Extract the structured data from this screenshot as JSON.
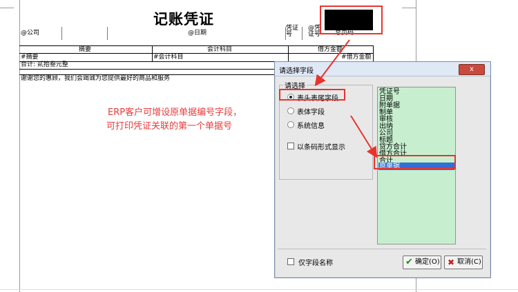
{
  "voucher": {
    "title": "记账凭证",
    "company_field": "@公司",
    "date_field": "@日期",
    "voucher_no_label": "凭证号",
    "voucher_no_field": "@凭证号",
    "total_pages": "总页码",
    "col_summary": "摘要",
    "col_account": "会计科目",
    "col_debit": "借方金额",
    "row_summary": "#摘要",
    "row_account": "#会计科目",
    "row_debit": "#借方金额",
    "total_label": "合计: 贰拾叁元整",
    "footer_note": "谢谢您的惠顾，我们会竭诚为您提供最好的商品和服务"
  },
  "annotation": {
    "line1": "ERP客户可增设原单据编号字段，",
    "line2": "可打印凭证关联的第一个单据号",
    "color": "#e83a3a"
  },
  "dialog": {
    "title": "请选择字段",
    "close_label": "x",
    "group_label": "请选择",
    "options": [
      {
        "label": "表头表尾字段",
        "selected": true
      },
      {
        "label": "表体字段",
        "selected": false
      },
      {
        "label": "系统信息",
        "selected": false
      }
    ],
    "barcode_label": "以条码形式显示",
    "field_list": [
      "凭证号",
      "日期",
      "附单据",
      "制单",
      "审核",
      "出纳",
      "公司",
      "标题",
      "贷方合计",
      "借方合计",
      "合计",
      "原单据"
    ],
    "selected_field": "原单据",
    "field_name_only_label": "仅字段名称",
    "ok_label": "确定(O)",
    "cancel_label": "取消(C)"
  }
}
